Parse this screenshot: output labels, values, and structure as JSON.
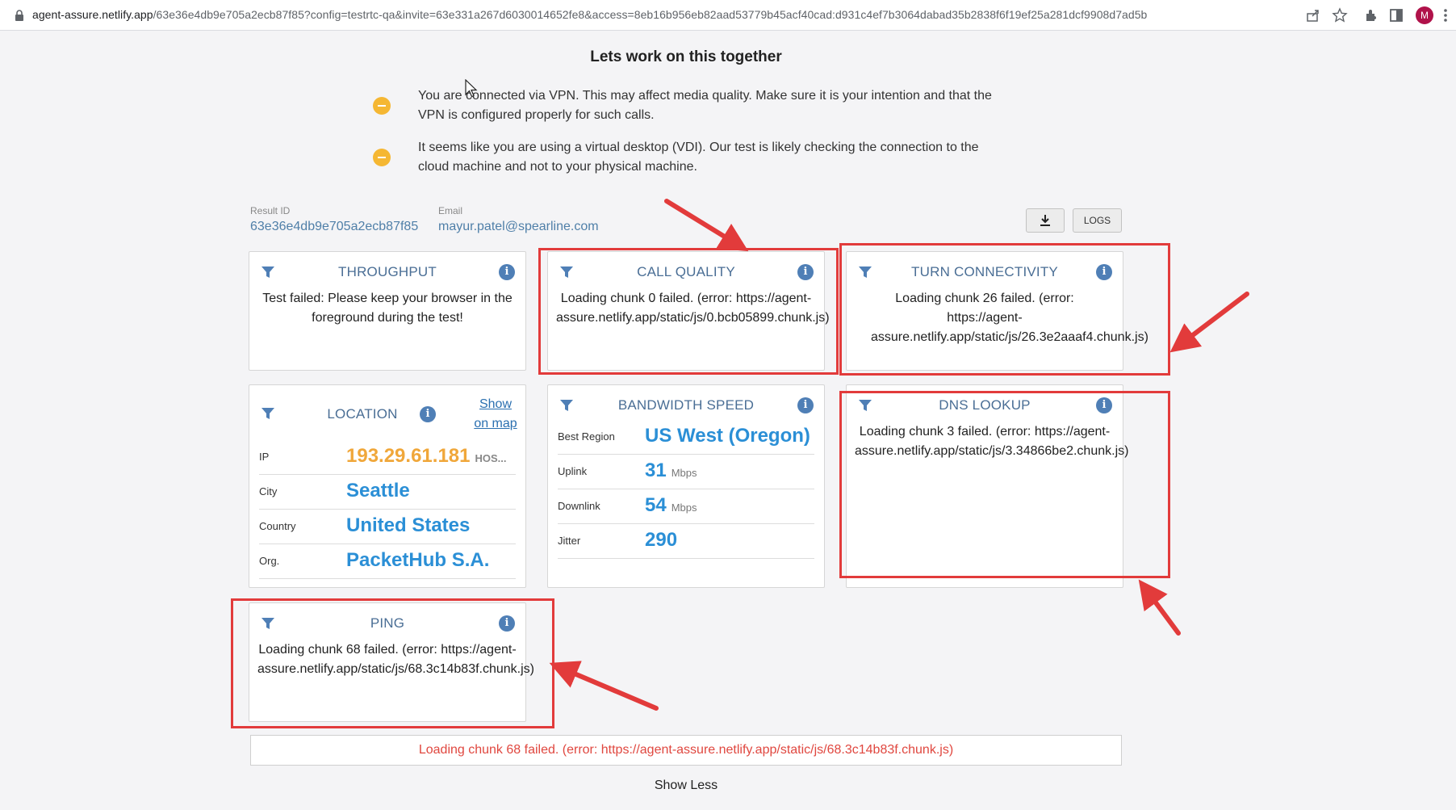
{
  "browser": {
    "url_host": "agent-assure.netlify.app",
    "url_rest": "/63e36e4db9e705a2ecb87f85?config=testrtc-qa&invite=63e331a267d6030014652fe8&access=8eb16b956eb82aad53779b45acf40cad:d931c4ef7b3064dabad35b2838f6f19ef25a281dcf9908d7ad5b",
    "avatar_letter": "M",
    "icons": [
      "lock-icon",
      "share-icon",
      "star-icon",
      "extensions-icon",
      "side-panel-icon",
      "menu-dots-icon"
    ]
  },
  "page": {
    "heading": "Lets work on this together",
    "warnings": [
      "You are connected via VPN. This may affect media quality. Make sure it is your intention and that the VPN is configured properly for such calls.",
      "It seems like you are using a virtual desktop (VDI). Our test is likely checking the connection to the cloud machine and not to your physical machine."
    ],
    "result_id_label": "Result ID",
    "result_id": "63e36e4db9e705a2ecb87f85",
    "email_label": "Email",
    "email": "mayur.patel@spearline.com",
    "download_button": "download-icon",
    "logs_button": "LOGS"
  },
  "cards": {
    "throughput": {
      "title": "THROUGHPUT",
      "message": "Test failed: Please keep your browser in the foreground during the test!"
    },
    "call_quality": {
      "title": "CALL QUALITY",
      "message": "Loading chunk 0 failed. (error: https://agent-assure.netlify.app/static/js/0.bcb05899.chunk.js)"
    },
    "turn": {
      "title": "TURN CONNECTIVITY",
      "message": "Loading chunk 26 failed. (error: https://agent-assure.netlify.app/static/js/26.3e2aaaf4.chunk.js)"
    },
    "location": {
      "title": "LOCATION",
      "show_map": "Show on map",
      "rows": [
        {
          "key": "IP",
          "value": "193.29.61.181",
          "suffix": "HOS..."
        },
        {
          "key": "City",
          "value": "Seattle"
        },
        {
          "key": "Country",
          "value": "United States"
        },
        {
          "key": "Org.",
          "value": "PacketHub S.A."
        }
      ]
    },
    "bandwidth": {
      "title": "BANDWIDTH SPEED",
      "rows": [
        {
          "key": "Best Region",
          "value": "US West (Oregon)",
          "unit": ""
        },
        {
          "key": "Uplink",
          "value": "31",
          "unit": "Mbps"
        },
        {
          "key": "Downlink",
          "value": "54",
          "unit": "Mbps"
        },
        {
          "key": "Jitter",
          "value": "290",
          "unit": ""
        }
      ]
    },
    "dns": {
      "title": "DNS LOOKUP",
      "message": "Loading chunk 3 failed. (error: https://agent-assure.netlify.app/static/js/3.34866be2.chunk.js)"
    },
    "ping": {
      "title": "PING",
      "message": "Loading chunk 68 failed. (error: https://agent-assure.netlify.app/static/js/68.3c14b83f.chunk.js)"
    }
  },
  "footer": {
    "error": "Loading chunk 68 failed. (error: https://agent-assure.netlify.app/static/js/68.3c14b83f.chunk.js)",
    "show_less": "Show Less"
  },
  "colors": {
    "accent": "#2b8fd6",
    "title_blue": "#4a6e95",
    "warning": "#f5b733",
    "ip_orange": "#f0a73a",
    "annotation_red": "#e23b3b",
    "error_red": "#e0473f"
  }
}
